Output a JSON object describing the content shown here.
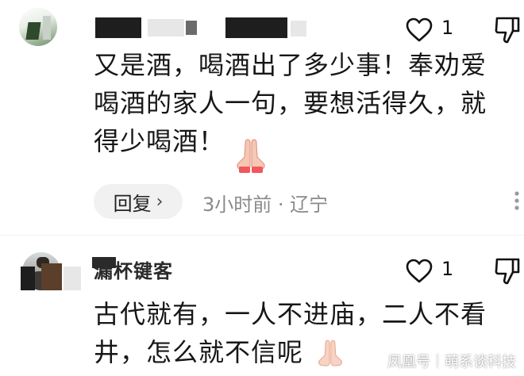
{
  "comments": [
    {
      "text_lines": [
        "又是酒，喝酒出了多少事！奉劝爱",
        "喝酒的家人一句，要想活得久，就",
        "得少喝酒！"
      ],
      "emoji": "pray-hands",
      "like_count": "1",
      "reply_label": "回复",
      "meta": "3小时前 · 辽宁"
    },
    {
      "username": "漏杯键客",
      "text_lines": [
        "古代就有，一人不进庙，二人不看",
        "井，怎么就不信呢"
      ],
      "emoji": "pray-hands",
      "like_count": "1"
    }
  ],
  "watermark": "凤凰号｜萌系谈科技",
  "icons": {
    "like": "heart-icon",
    "dislike": "thumbs-down-icon",
    "more": "more-dots-icon",
    "reply_chevron": "chevron-right-icon"
  },
  "colors": {
    "text": "#171717",
    "meta": "#8a8a8a",
    "reply_bg": "#f1f1f1",
    "emoji": "#f2a7a7"
  }
}
